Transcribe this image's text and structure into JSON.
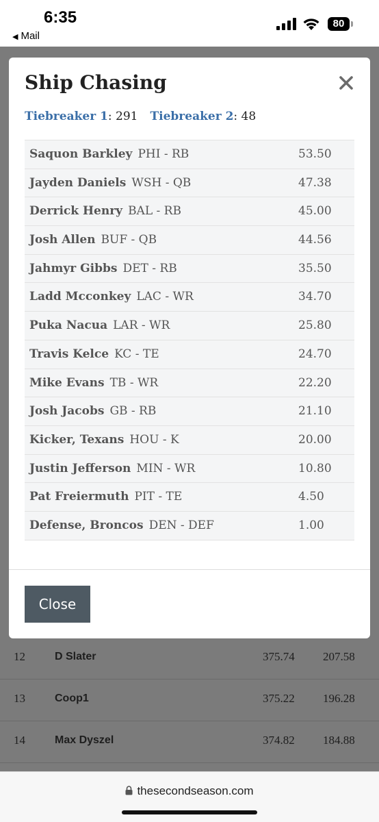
{
  "status_bar": {
    "time": "6:35",
    "back_app": "Mail",
    "battery": "80"
  },
  "modal": {
    "title": "Ship Chasing",
    "tiebreaker1_label": "Tiebreaker 1",
    "tiebreaker1_value": "291",
    "tiebreaker2_label": "Tiebreaker 2",
    "tiebreaker2_value": "48",
    "close_button_label": "Close",
    "players": [
      {
        "name": "Saquon Barkley",
        "team_pos": "PHI - RB",
        "points": "53.50"
      },
      {
        "name": "Jayden Daniels",
        "team_pos": "WSH - QB",
        "points": "47.38"
      },
      {
        "name": "Derrick Henry",
        "team_pos": "BAL - RB",
        "points": "45.00"
      },
      {
        "name": "Josh Allen",
        "team_pos": "BUF - QB",
        "points": "44.56"
      },
      {
        "name": "Jahmyr Gibbs",
        "team_pos": "DET - RB",
        "points": "35.50"
      },
      {
        "name": "Ladd Mcconkey",
        "team_pos": "LAC - WR",
        "points": "34.70"
      },
      {
        "name": "Puka Nacua",
        "team_pos": "LAR - WR",
        "points": "25.80"
      },
      {
        "name": "Travis Kelce",
        "team_pos": "KC - TE",
        "points": "24.70"
      },
      {
        "name": "Mike Evans",
        "team_pos": "TB - WR",
        "points": "22.20"
      },
      {
        "name": "Josh Jacobs",
        "team_pos": "GB - RB",
        "points": "21.10"
      },
      {
        "name": "Kicker, Texans",
        "team_pos": "HOU - K",
        "points": "20.00"
      },
      {
        "name": "Justin Jefferson",
        "team_pos": "MIN - WR",
        "points": "10.80"
      },
      {
        "name": "Pat Freiermuth",
        "team_pos": "PIT - TE",
        "points": "4.50"
      },
      {
        "name": "Defense, Broncos",
        "team_pos": "DEN - DEF",
        "points": "1.00"
      }
    ]
  },
  "background_standings": [
    {
      "rank": "12",
      "name": "D Slater",
      "total": "375.74",
      "week": "207.58"
    },
    {
      "rank": "13",
      "name": "Coop1",
      "total": "375.22",
      "week": "196.28"
    },
    {
      "rank": "14",
      "name": "Max Dyszel",
      "total": "374.82",
      "week": "184.88"
    }
  ],
  "browser": {
    "url": "thesecondseason.com"
  },
  "colors": {
    "accent_link": "#3b6fa8",
    "close_button_bg": "#4e5a63",
    "overlay": "#7b7b7b"
  }
}
